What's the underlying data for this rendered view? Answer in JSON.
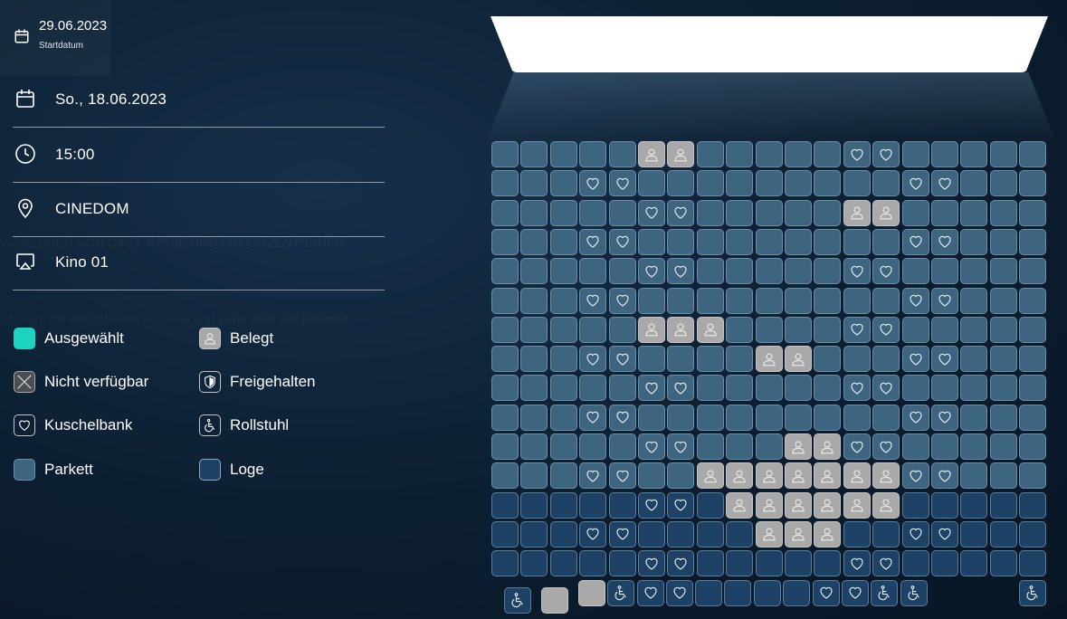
{
  "start": {
    "date": "29.06.2023",
    "label": "Startdatum"
  },
  "info": [
    {
      "icon": "calendar-icon",
      "text": "So., 18.06.2023"
    },
    {
      "icon": "clock-icon",
      "text": "15:00"
    },
    {
      "icon": "location-pin-icon",
      "text": "CINEDOM"
    },
    {
      "icon": "screen-icon",
      "text": "Kino 01"
    }
  ],
  "legend": [
    {
      "name": "selected",
      "label": "Ausgewählt"
    },
    {
      "name": "occupied",
      "label": "Belegt"
    },
    {
      "name": "unavailable",
      "label": "Nicht verfügbar"
    },
    {
      "name": "reserved",
      "label": "Freigehalten"
    },
    {
      "name": "love-seat",
      "label": "Kuschelbank"
    },
    {
      "name": "wheelchair",
      "label": "Rollstuhl"
    },
    {
      "name": "parkett",
      "label": "Parkett"
    },
    {
      "name": "loge",
      "label": "Loge"
    }
  ],
  "colors": {
    "background": "#0d2033",
    "selected": "#1dd3c0",
    "occupied": "#a9a9a9",
    "parkett": "#3e6580",
    "loge": "#1d4265",
    "screen": "#ffffff"
  },
  "seatmap": {
    "legend_key": "P = Parkett, L = Loge, O = belegt, H = Kuschelbank, W = Rollstuhl, X = belegter Rollstuhlplatz, - = kein Sitz",
    "rows": [
      "PPPPPOOPPPPPHHPPPPP",
      "PPPHHPPPPPPPPPHHPPP",
      "PPPPPHHPPPPPOOPPPPP",
      "PPPHHPPPPPPPPPHHPPP",
      "PPPPPHHPPPPPHHPPPPP",
      "PPPHHPPPPPPPPPHHPPP",
      "PPPPPOOOPPPPHHPPPPP",
      "PPPHHPPPPOOPPPHHPPP",
      "PPPPPHHPPPPPHHPPPPP",
      "PPPHHPPPPPPPPPHHPPP",
      "PPPPPHHPPPOOHHPPPPP",
      "PPPHHPPOOOOOOOHHPPP",
      "LLLLLHHLOOOOOOLLLLL",
      "LLLHHLLLLOOOLLHHLLL",
      "LLLLLHHLLLLLHHLLLLL",
      "-W-X-XWHHLLLLHHWW-W-W"
    ]
  },
  "hidden_text": [
    "WESENDEN VON CAST, REGIE UND PRODUZENT*INNEN",
    "Ein Film mit den Inhalten von Lisa und Lena über viel Freundin"
  ]
}
